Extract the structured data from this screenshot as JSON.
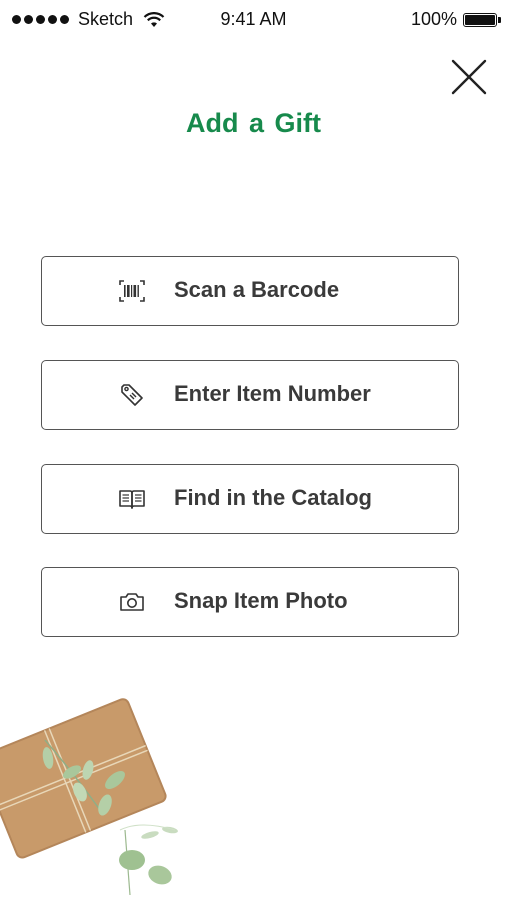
{
  "status_bar": {
    "carrier": "Sketch",
    "time": "9:41 AM",
    "battery": "100%"
  },
  "header": {
    "title": "Add a  Gift",
    "close_icon": "close-icon"
  },
  "options": [
    {
      "label": "Scan a Barcode",
      "icon": "barcode-icon"
    },
    {
      "label": "Enter Item Number",
      "icon": "tag-icon"
    },
    {
      "label": "Find in the Catalog",
      "icon": "book-icon"
    },
    {
      "label": "Snap Item Photo",
      "icon": "camera-icon"
    }
  ],
  "colors": {
    "accent": "#178a4c",
    "button_border": "#555555",
    "text": "#3a3a3a",
    "kraft_paper": "#c89a6a",
    "leaf": "#a9c79b"
  }
}
